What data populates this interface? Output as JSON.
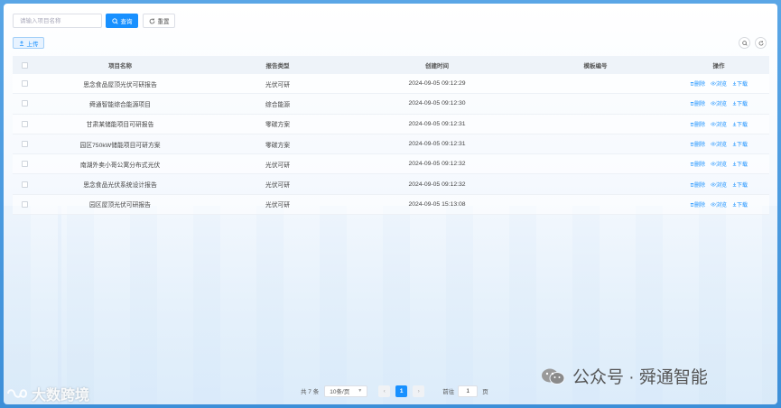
{
  "search": {
    "placeholder": "请输入项目名称",
    "query_label": "查询",
    "reset_label": "重置"
  },
  "toolbar": {
    "upload_label": "上传"
  },
  "table": {
    "headers": {
      "name": "项目名称",
      "type": "报告类型",
      "time": "创建时间",
      "template": "模板编号",
      "ops": "操作"
    },
    "op_labels": {
      "delete": "删除",
      "browse": "浏览",
      "download": "下载"
    },
    "rows": [
      {
        "name": "思念食品屋顶光伏可研报告",
        "type": "光伏可研",
        "time": "2024-09-05 09:12:29",
        "template": ""
      },
      {
        "name": "舜通智能综合能源项目",
        "type": "综合能源",
        "time": "2024-09-05 09:12:30",
        "template": ""
      },
      {
        "name": "甘肃某储能项目可研报告",
        "type": "零碳方案",
        "time": "2024-09-05 09:12:31",
        "template": ""
      },
      {
        "name": "园区750kW储能项目可研方案",
        "type": "零碳方案",
        "time": "2024-09-05 09:12:31",
        "template": ""
      },
      {
        "name": "南湖外卖小哥公寓分布式光伏",
        "type": "光伏可研",
        "time": "2024-09-05 09:12:32",
        "template": ""
      },
      {
        "name": "思念食品光伏系统设计报告",
        "type": "光伏可研",
        "time": "2024-09-05 09:12:32",
        "template": ""
      },
      {
        "name": "园区屋顶光伏可研报告",
        "type": "光伏可研",
        "time": "2024-09-05 15:13:08",
        "template": ""
      }
    ]
  },
  "pagination": {
    "total_label": "共 7 条",
    "page_size_label": "10条/页",
    "current_page": "1",
    "goto_label": "前往",
    "goto_value": "1",
    "unit_label": "页"
  },
  "watermarks": {
    "left": "大数跨境",
    "right": "公众号 · 舜通智能"
  },
  "colors": {
    "primary": "#1890ff",
    "background": "#4a9ae0"
  },
  "icons": {
    "query": "search-icon",
    "reset": "refresh-icon",
    "upload": "upload-icon",
    "delete": "trash-icon",
    "browse": "eye-icon",
    "download": "download-icon"
  }
}
